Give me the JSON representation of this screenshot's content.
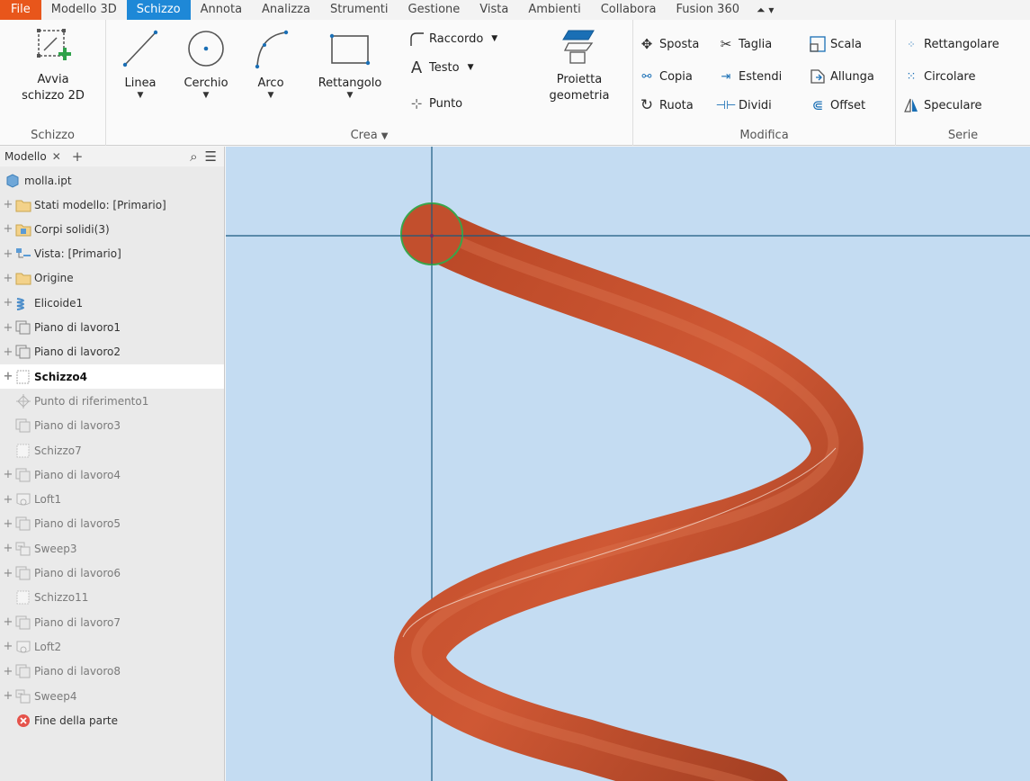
{
  "menu": {
    "items": [
      "File",
      "Modello 3D",
      "Schizzo",
      "Annota",
      "Analizza",
      "Strumenti",
      "Gestione",
      "Vista",
      "Ambienti",
      "Collabora",
      "Fusion 360"
    ],
    "active": "Schizzo"
  },
  "ribbon": {
    "panel_schizzo": {
      "title": "Schizzo",
      "start_sketch_line1": "Avvia",
      "start_sketch_line2": "schizzo 2D"
    },
    "panel_crea": {
      "title": "Crea",
      "line": "Linea",
      "circle": "Cerchio",
      "arc": "Arco",
      "rectangle": "Rettangolo",
      "fillet": "Raccordo",
      "text": "Testo",
      "point": "Punto",
      "project_line1": "Proietta",
      "project_line2": "geometria"
    },
    "panel_modifica": {
      "title": "Modifica",
      "move": "Sposta",
      "trim": "Taglia",
      "scale": "Scala",
      "copy": "Copia",
      "extend": "Estendi",
      "stretch": "Allunga",
      "rotate": "Ruota",
      "split": "Dividi",
      "offset": "Offset"
    },
    "panel_serie": {
      "title": "Serie",
      "rectangular": "Rettangolare",
      "circular": "Circolare",
      "mirror": "Speculare"
    }
  },
  "browser": {
    "tab_label": "Modello",
    "root": "molla.ipt",
    "items": [
      {
        "label": "Stati modello: [Primario]",
        "icon": "folder-icon",
        "state": "normal"
      },
      {
        "label": "Corpi solidi(3)",
        "icon": "solid-bodies-icon",
        "state": "normal"
      },
      {
        "label": "Vista: [Primario]",
        "icon": "view-rep-icon",
        "state": "normal"
      },
      {
        "label": "Origine",
        "icon": "folder-icon",
        "state": "normal"
      },
      {
        "label": "Elicoide1",
        "icon": "coil-icon",
        "state": "normal"
      },
      {
        "label": "Piano di lavoro1",
        "icon": "work-plane-icon",
        "state": "normal"
      },
      {
        "label": "Piano di lavoro2",
        "icon": "work-plane-icon",
        "state": "normal"
      },
      {
        "label": "Schizzo4",
        "icon": "sketch-icon",
        "state": "selected"
      },
      {
        "label": "Punto di riferimento1",
        "icon": "work-point-icon",
        "state": "dim"
      },
      {
        "label": "Piano di lavoro3",
        "icon": "work-plane-icon",
        "state": "dim"
      },
      {
        "label": "Schizzo7",
        "icon": "sketch-icon",
        "state": "dim"
      },
      {
        "label": "Piano di lavoro4",
        "icon": "work-plane-icon",
        "state": "dim"
      },
      {
        "label": "Loft1",
        "icon": "loft-icon",
        "state": "dim"
      },
      {
        "label": "Piano di lavoro5",
        "icon": "work-plane-icon",
        "state": "dim"
      },
      {
        "label": "Sweep3",
        "icon": "sweep-icon",
        "state": "dim"
      },
      {
        "label": "Piano di lavoro6",
        "icon": "work-plane-icon",
        "state": "dim"
      },
      {
        "label": "Schizzo11",
        "icon": "sketch-icon",
        "state": "dim"
      },
      {
        "label": "Piano di lavoro7",
        "icon": "work-plane-icon",
        "state": "dim"
      },
      {
        "label": "Loft2",
        "icon": "loft-icon",
        "state": "dim"
      },
      {
        "label": "Piano di lavoro8",
        "icon": "work-plane-icon",
        "state": "dim"
      },
      {
        "label": "Sweep4",
        "icon": "sweep-icon",
        "state": "dim"
      },
      {
        "label": "Fine della parte",
        "icon": "end-of-part-icon",
        "state": "end"
      }
    ]
  },
  "colors": {
    "accent": "#1e88d7",
    "file_menu": "#e8561b",
    "viewport_bg": "#c4dcf2",
    "spring": "#c9532f",
    "axis": "#1a5a80",
    "sketch_circle": "#3aa44a"
  }
}
